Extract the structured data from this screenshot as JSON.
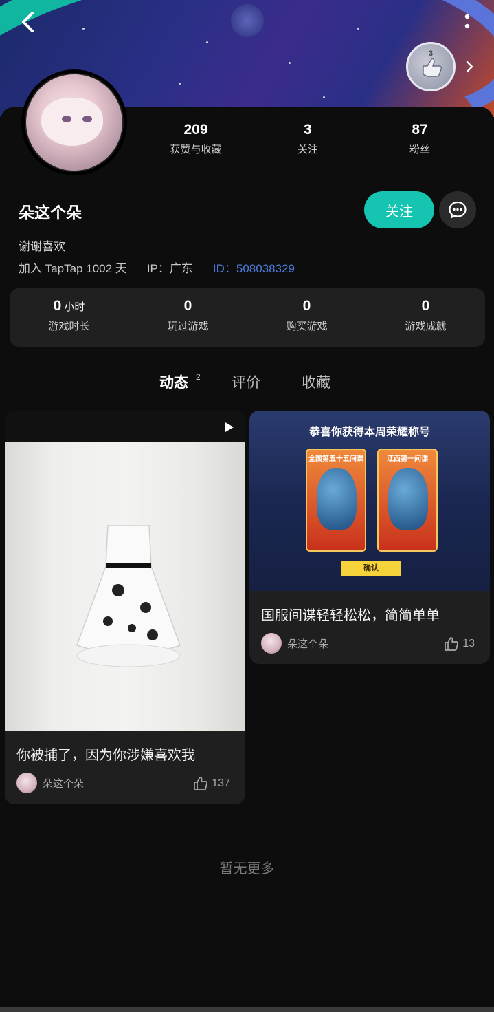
{
  "header": {
    "back_icon": "back-arrow-icon",
    "more_icon": "more-vertical-icon",
    "badge_count": "3"
  },
  "profile": {
    "stats": [
      {
        "value": "209",
        "label": "获赞与收藏"
      },
      {
        "value": "3",
        "label": "关注"
      },
      {
        "value": "87",
        "label": "粉丝"
      }
    ],
    "nickname": "朵这个朵",
    "follow_label": "关注",
    "bio": "谢谢喜欢",
    "joined": "加入 TapTap 1002 天",
    "ip": "IP：广东",
    "id": "ID：508038329"
  },
  "game_stats": [
    {
      "value": "0",
      "unit": "小时",
      "label": "游戏时长"
    },
    {
      "value": "0",
      "unit": "",
      "label": "玩过游戏"
    },
    {
      "value": "0",
      "unit": "",
      "label": "购买游戏"
    },
    {
      "value": "0",
      "unit": "",
      "label": "游戏成就"
    }
  ],
  "tabs": [
    {
      "label": "动态",
      "count": "2",
      "active": true
    },
    {
      "label": "评价",
      "count": "",
      "active": false
    },
    {
      "label": "收藏",
      "count": "",
      "active": false
    }
  ],
  "posts": [
    {
      "title": "你被捕了，因为你涉嫌喜欢我",
      "author": "朵这个朵",
      "likes": "137",
      "is_video": true
    },
    {
      "title": "国服间谍轻轻松松，简简单单",
      "author": "朵这个朵",
      "likes": "13",
      "is_video": false,
      "thumb_banner": "恭喜你获得本周荣耀称号",
      "thumb_left_caption": "全国第五十五间谍",
      "thumb_right_caption": "江西第一间谍",
      "thumb_button": "确认"
    }
  ],
  "footer": {
    "no_more": "暂无更多"
  },
  "colors": {
    "accent": "#15c5b1",
    "id_link": "#4b7bd9",
    "background": "#000000",
    "card": "#1f1f1f"
  }
}
